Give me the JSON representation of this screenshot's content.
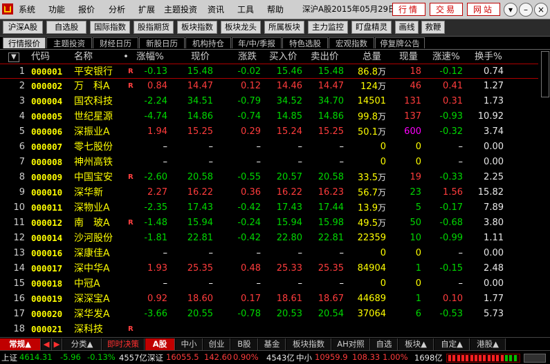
{
  "menu": [
    "系统",
    "功能",
    "报价",
    "分析",
    "扩展",
    "主题投资",
    "资讯",
    "工具",
    "帮助"
  ],
  "window_title": "深沪A股2015年05月29日",
  "top_buttons": [
    "行情",
    "交易",
    "网站"
  ],
  "window_controls": [
    "▾",
    "–",
    "□",
    "×"
  ],
  "toolbar": [
    "沪深A股",
    "自选股",
    "国际指数",
    "股指期货",
    "板块指数",
    "板块龙头",
    "所属板块",
    "主力监控",
    "盯盘精灵",
    "画线",
    "救鞭"
  ],
  "subtabs": [
    "行情报价",
    "主题投资",
    "财经日历",
    "新股日历",
    "机构持仓",
    "年/中/季报",
    "特色选股",
    "宏观指数",
    "停复牌公告"
  ],
  "headers": {
    "sort": "▼",
    "code": "代码",
    "name": "名称",
    "dot": "•",
    "pct": "涨幅%",
    "price": "现价",
    "chg": "涨跌",
    "bid": "买入价",
    "ask": "卖出价",
    "vol": "总量",
    "cur": "现量",
    "speed": "涨速%",
    "turn": "换手%"
  },
  "rows": [
    {
      "idx": "1",
      "code": "000001",
      "name": "平安银行",
      "flag": "R",
      "pct": "-0.13",
      "price": "15.48",
      "chg": "-0.02",
      "bid": "15.46",
      "ask": "15.48",
      "vol": "86.8",
      "vol_unit": "万",
      "cur": "18",
      "speed": "-0.12",
      "turn": "0.74",
      "dir": "down",
      "cur_color": "up",
      "speed_dir": "down"
    },
    {
      "idx": "2",
      "code": "000002",
      "name": "万　科A",
      "flag": "R",
      "pct": "0.84",
      "price": "14.47",
      "chg": "0.12",
      "bid": "14.46",
      "ask": "14.47",
      "vol": "124",
      "vol_unit": "万",
      "cur": "46",
      "speed": "0.41",
      "turn": "1.27",
      "dir": "up",
      "cur_color": "up",
      "speed_dir": "up"
    },
    {
      "idx": "3",
      "code": "000004",
      "name": "国农科技",
      "flag": "",
      "pct": "-2.24",
      "price": "34.51",
      "chg": "-0.79",
      "bid": "34.52",
      "ask": "34.70",
      "vol": "14501",
      "vol_unit": "",
      "cur": "131",
      "speed": "0.31",
      "turn": "1.73",
      "dir": "down",
      "cur_color": "up",
      "speed_dir": "up"
    },
    {
      "idx": "4",
      "code": "000005",
      "name": "世纪星源",
      "flag": "",
      "pct": "-4.74",
      "price": "14.86",
      "chg": "-0.74",
      "bid": "14.85",
      "ask": "14.86",
      "vol": "99.8",
      "vol_unit": "万",
      "cur": "137",
      "speed": "-0.93",
      "turn": "10.92",
      "dir": "down",
      "cur_color": "up",
      "speed_dir": "down"
    },
    {
      "idx": "5",
      "code": "000006",
      "name": "深振业A",
      "flag": "",
      "pct": "1.94",
      "price": "15.25",
      "chg": "0.29",
      "bid": "15.24",
      "ask": "15.25",
      "vol": "50.1",
      "vol_unit": "万",
      "cur": "600",
      "speed": "-0.32",
      "turn": "3.74",
      "dir": "up",
      "cur_color": "mag",
      "speed_dir": "down"
    },
    {
      "idx": "6",
      "code": "000007",
      "name": "零七股份",
      "flag": "",
      "pct": "–",
      "price": "–",
      "chg": "–",
      "bid": "–",
      "ask": "–",
      "vol": "0",
      "vol_unit": "",
      "cur": "0",
      "speed": "–",
      "turn": "0.00",
      "dir": "zero",
      "cur_color": "yel",
      "speed_dir": "zero"
    },
    {
      "idx": "7",
      "code": "000008",
      "name": "神州高铁",
      "flag": "",
      "pct": "–",
      "price": "–",
      "chg": "–",
      "bid": "–",
      "ask": "–",
      "vol": "0",
      "vol_unit": "",
      "cur": "0",
      "speed": "–",
      "turn": "0.00",
      "dir": "zero",
      "cur_color": "yel",
      "speed_dir": "zero"
    },
    {
      "idx": "8",
      "code": "000009",
      "name": "中国宝安",
      "flag": "R",
      "pct": "-2.60",
      "price": "20.58",
      "chg": "-0.55",
      "bid": "20.57",
      "ask": "20.58",
      "vol": "33.5",
      "vol_unit": "万",
      "cur": "19",
      "speed": "-0.33",
      "turn": "2.25",
      "dir": "down",
      "cur_color": "up",
      "speed_dir": "down"
    },
    {
      "idx": "9",
      "code": "000010",
      "name": "深华新",
      "flag": "",
      "pct": "2.27",
      "price": "16.22",
      "chg": "0.36",
      "bid": "16.22",
      "ask": "16.23",
      "vol": "56.7",
      "vol_unit": "万",
      "cur": "23",
      "speed": "1.56",
      "turn": "15.82",
      "dir": "up",
      "cur_color": "down",
      "speed_dir": "up"
    },
    {
      "idx": "10",
      "code": "000011",
      "name": "深物业A",
      "flag": "",
      "pct": "-2.35",
      "price": "17.43",
      "chg": "-0.42",
      "bid": "17.43",
      "ask": "17.44",
      "vol": "13.9",
      "vol_unit": "万",
      "cur": "5",
      "speed": "-0.17",
      "turn": "7.89",
      "dir": "down",
      "cur_color": "down",
      "speed_dir": "down"
    },
    {
      "idx": "11",
      "code": "000012",
      "name": "南　玻A",
      "flag": "R",
      "pct": "-1.48",
      "price": "15.94",
      "chg": "-0.24",
      "bid": "15.94",
      "ask": "15.98",
      "vol": "49.5",
      "vol_unit": "万",
      "cur": "50",
      "speed": "-0.68",
      "turn": "3.80",
      "dir": "down",
      "cur_color": "down",
      "speed_dir": "down"
    },
    {
      "idx": "12",
      "code": "000014",
      "name": "沙河股份",
      "flag": "",
      "pct": "-1.81",
      "price": "22.81",
      "chg": "-0.42",
      "bid": "22.80",
      "ask": "22.81",
      "vol": "22359",
      "vol_unit": "",
      "cur": "10",
      "speed": "-0.99",
      "turn": "1.11",
      "dir": "down",
      "cur_color": "down",
      "speed_dir": "down"
    },
    {
      "idx": "13",
      "code": "000016",
      "name": "深康佳A",
      "flag": "",
      "pct": "–",
      "price": "–",
      "chg": "–",
      "bid": "–",
      "ask": "–",
      "vol": "0",
      "vol_unit": "",
      "cur": "0",
      "speed": "–",
      "turn": "0.00",
      "dir": "zero",
      "cur_color": "yel",
      "speed_dir": "zero"
    },
    {
      "idx": "14",
      "code": "000017",
      "name": "深中华A",
      "flag": "",
      "pct": "1.93",
      "price": "25.35",
      "chg": "0.48",
      "bid": "25.33",
      "ask": "25.35",
      "vol": "84904",
      "vol_unit": "",
      "cur": "1",
      "speed": "-0.15",
      "turn": "2.48",
      "dir": "up",
      "cur_color": "down",
      "speed_dir": "down"
    },
    {
      "idx": "15",
      "code": "000018",
      "name": "中冠A",
      "flag": "",
      "pct": "–",
      "price": "–",
      "chg": "–",
      "bid": "–",
      "ask": "–",
      "vol": "0",
      "vol_unit": "",
      "cur": "0",
      "speed": "–",
      "turn": "0.00",
      "dir": "zero",
      "cur_color": "yel",
      "speed_dir": "zero"
    },
    {
      "idx": "16",
      "code": "000019",
      "name": "深深宝A",
      "flag": "",
      "pct": "0.92",
      "price": "18.60",
      "chg": "0.17",
      "bid": "18.61",
      "ask": "18.67",
      "vol": "44689",
      "vol_unit": "",
      "cur": "1",
      "speed": "0.10",
      "turn": "1.77",
      "dir": "up",
      "cur_color": "down",
      "speed_dir": "up"
    },
    {
      "idx": "17",
      "code": "000020",
      "name": "深华发A",
      "flag": "",
      "pct": "-3.66",
      "price": "20.55",
      "chg": "-0.78",
      "bid": "20.53",
      "ask": "20.54",
      "vol": "37064",
      "vol_unit": "",
      "cur": "6",
      "speed": "-0.53",
      "turn": "5.73",
      "dir": "down",
      "cur_color": "down",
      "speed_dir": "down"
    },
    {
      "idx": "18",
      "code": "000021",
      "name": "深科技",
      "flag": "R",
      "pct": "",
      "price": "",
      "chg": "",
      "bid": "",
      "ask": "",
      "vol": "",
      "vol_unit": "",
      "cur": "",
      "speed": "",
      "turn": "",
      "dir": "zero",
      "cur_color": "yel",
      "speed_dir": "zero"
    }
  ],
  "bottom_tabs": [
    "常规▲",
    "◀",
    "▶",
    "分类▲",
    "即时决策",
    "A股",
    "中小",
    "创业",
    "B股",
    "基金",
    "板块指数",
    "AH对照",
    "自选",
    "板块▲",
    "自定▲",
    "港股▲"
  ],
  "status": {
    "sh_label": "上证",
    "sh_index": "4614.31",
    "sh_chg": "-5.96",
    "sh_pct": "-0.13%",
    "sh_amt": "4557亿",
    "sz_label": "深证",
    "sz_index": "16055.5",
    "sz_chg": "142.60",
    "sz_pct": "0.90%",
    "sz_amt": "4543亿",
    "zx_label": "中小",
    "zx_index": "10959.9",
    "zx_chg": "108.33",
    "zx_pct": "1.00%",
    "zx_amt": "1698亿"
  },
  "colors": {
    "up": "#ff3c3c",
    "down": "#00d800",
    "code": "#ffff00",
    "accent": "#c00000"
  }
}
